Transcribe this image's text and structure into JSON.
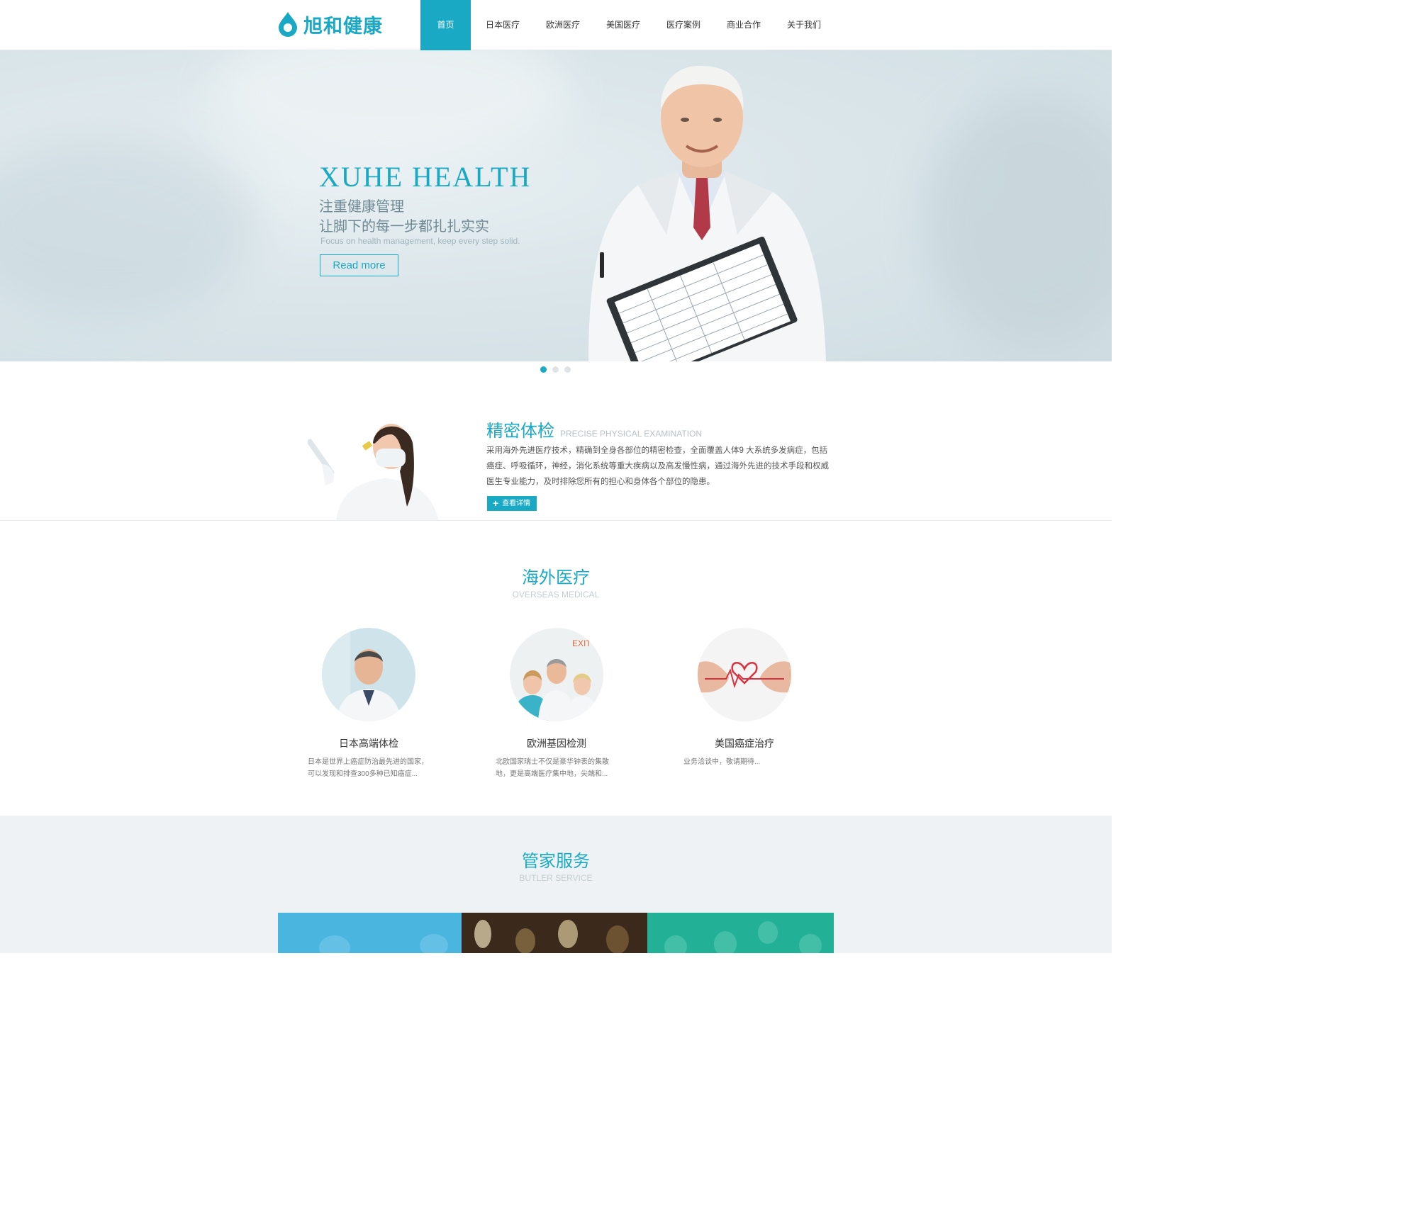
{
  "brand": {
    "name": "旭和健康",
    "color": "#1aa9c4"
  },
  "nav": {
    "items": [
      {
        "label": "首页",
        "active": true
      },
      {
        "label": "日本医疗",
        "active": false
      },
      {
        "label": "欧洲医疗",
        "active": false
      },
      {
        "label": "美国医疗",
        "active": false
      },
      {
        "label": "医疗案例",
        "active": false
      },
      {
        "label": "商业合作",
        "active": false
      },
      {
        "label": "关于我们",
        "active": false
      }
    ]
  },
  "banner": {
    "title": "XUHE HEALTH",
    "line1": "注重健康管理",
    "line2": "让脚下的每一步都扎扎实实",
    "en": "Focus on health management, keep every step solid.",
    "button": "Read more",
    "slides": 3,
    "active_slide": 1
  },
  "exam": {
    "title_cn": "精密体检",
    "title_en": "PRECISE PHYSICAL EXAMINATION",
    "description": "采用海外先进医疗技术，精确到全身各部位的精密检查，全面覆盖人体9 大系统多发病症，包括癌症、呼吸循环，神经，消化系统等重大疾病以及高发慢性病，通过海外先进的技术手段和权威医生专业能力，及时排除您所有的担心和身体各个部位的隐患。",
    "button": "查看详情"
  },
  "overseas": {
    "title_cn": "海外医疗",
    "title_en": "OVERSEAS MEDICAL",
    "cards": [
      {
        "title": "日本高端体检",
        "desc": "日本是世界上癌症防治最先进的国家，可以发现和排查300多种已知癌症..."
      },
      {
        "title": "欧洲基因检测",
        "desc": "北欧国家瑞士不仅是豪华钟表的集散地，更是高端医疗集中地，尖端和..."
      },
      {
        "title": "美国癌症治疗",
        "desc": "业务洽谈中，敬请期待..."
      }
    ]
  },
  "butler": {
    "title_cn": "管家服务",
    "title_en": "BUTLER SERVICE"
  }
}
